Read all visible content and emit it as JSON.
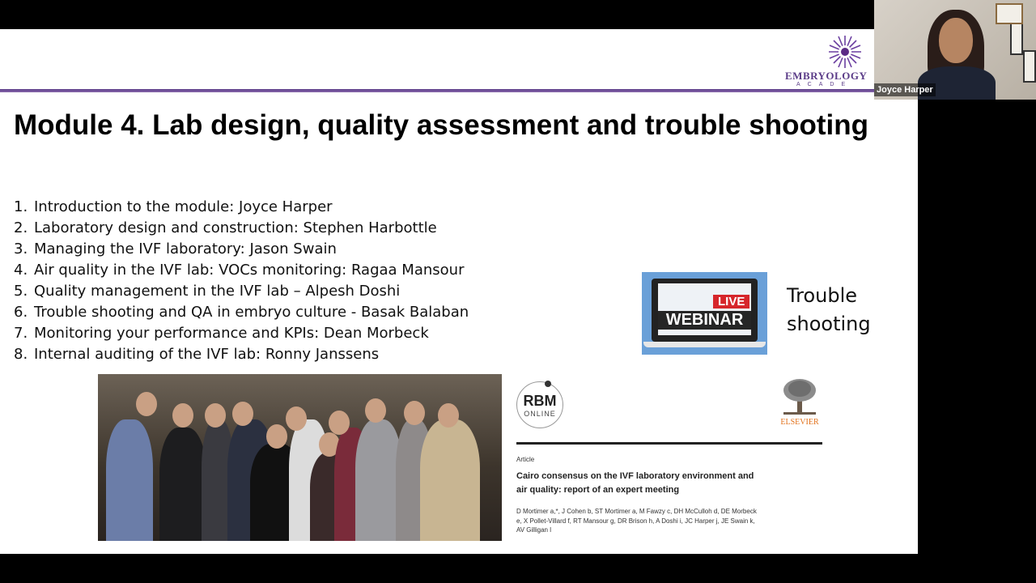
{
  "slide": {
    "logo_text": "EMBRYOLOGY",
    "logo_subtext": "ACADE",
    "title": "Module 4.  Lab design, quality assessment and trouble shooting",
    "agenda": [
      {
        "num": "1.",
        "text": "Introduction to the module: Joyce Harper"
      },
      {
        "num": "2.",
        "text": "Laboratory design and construction: Stephen Harbottle"
      },
      {
        "num": "3.",
        "text": "Managing the IVF laboratory: Jason Swain"
      },
      {
        "num": "4.",
        "text": "Air quality in the IVF lab: VOCs monitoring: Ragaa Mansour"
      },
      {
        "num": "5.",
        "text": "Quality management in the IVF lab – Alpesh Doshi"
      },
      {
        "num": "6.",
        "text": "Trouble shooting and QA in embryo culture - Basak Balaban"
      },
      {
        "num": "7.",
        "text": "Monitoring your performance and KPIs:  Dean Morbeck"
      },
      {
        "num": "8.",
        "text": "Internal auditing of the IVF lab: Ronny Janssens"
      }
    ],
    "webinar": {
      "live": "LIVE",
      "word": "WEBINAR"
    },
    "trouble_line1": "Trouble",
    "trouble_line2": "shooting",
    "paper": {
      "rbm_main": "RBM",
      "rbm_sub": "ONLINE",
      "publisher": "ELSEVIER",
      "article_type": "Article",
      "article_title": "Cairo consensus on the IVF laboratory environment and air quality: report of an expert meeting",
      "authors": "D Mortimer a,*, J Cohen b, ST Mortimer a, M Fawzy c, DH McCulloh d, DE Morbeck e, X Pollet-Villard f, RT Mansour g, DR Brison h, A Doshi i, JC Harper j, JE Swain k, AV Gilligan l"
    }
  },
  "video": {
    "participant_name": "Joyce Harper"
  },
  "colors": {
    "accent": "#5b3c88",
    "live_red": "#d6262b",
    "elsevier_orange": "#e2721c"
  }
}
